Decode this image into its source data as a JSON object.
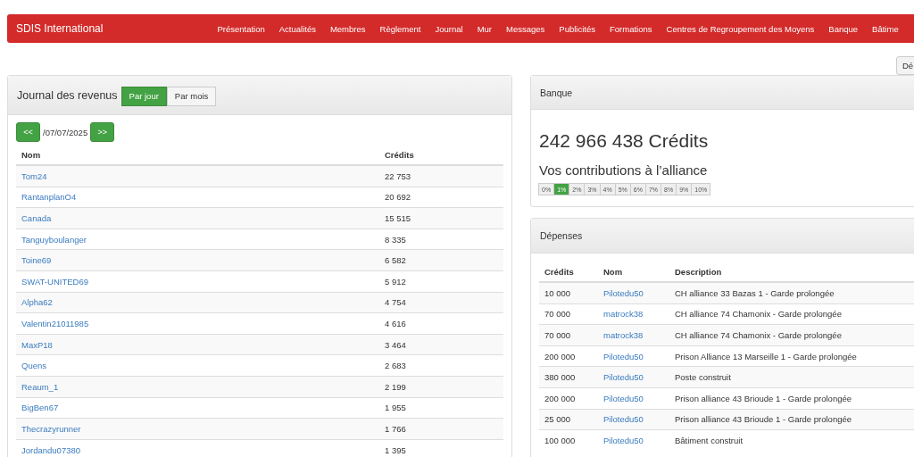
{
  "navbar": {
    "brand": "SDIS International",
    "items": [
      "Présentation",
      "Actualités",
      "Membres",
      "Règlement",
      "Journal",
      "Mur",
      "Messages",
      "Publicités",
      "Formations",
      "Centres de Regroupement des Moyens",
      "Banque",
      "Bâtime"
    ]
  },
  "top_button": "Dé",
  "income_journal": {
    "title": "Journal des revenus",
    "tabs": [
      {
        "label": "Par jour",
        "selected": true
      },
      {
        "label": "Par mois",
        "selected": false
      }
    ],
    "prev": "<<",
    "date": "/07/07/2025",
    "next": ">>",
    "columns": [
      "Nom",
      "Crédits"
    ],
    "rows": [
      {
        "name": "Tom24",
        "credits": "22 753"
      },
      {
        "name": "RantanplanO4",
        "credits": "20 692"
      },
      {
        "name": "Canada",
        "credits": "15 515"
      },
      {
        "name": "Tanguyboulanger",
        "credits": "8 335"
      },
      {
        "name": "Toine69",
        "credits": "6 582"
      },
      {
        "name": "SWAT-UNITED69",
        "credits": "5 912"
      },
      {
        "name": "Alpha62",
        "credits": "4 754"
      },
      {
        "name": "Valentin21011985",
        "credits": "4 616"
      },
      {
        "name": "MaxP18",
        "credits": "3 464"
      },
      {
        "name": "Quens",
        "credits": "2 683"
      },
      {
        "name": "Reaum_1",
        "credits": "2 199"
      },
      {
        "name": "BigBen67",
        "credits": "1 955"
      },
      {
        "name": "Thecrazyrunner",
        "credits": "1 766"
      },
      {
        "name": "Jordandu07380",
        "credits": "1 395"
      }
    ]
  },
  "bank": {
    "title": "Banque",
    "balance": "242 966 438 Crédits",
    "contributions_title": "Vos contributions à l’alliance",
    "options": [
      {
        "label": "0%",
        "selected": false
      },
      {
        "label": "1%",
        "selected": true
      },
      {
        "label": "2%",
        "selected": false
      },
      {
        "label": "3%",
        "selected": false
      },
      {
        "label": "4%",
        "selected": false
      },
      {
        "label": "5%",
        "selected": false
      },
      {
        "label": "6%",
        "selected": false
      },
      {
        "label": "7%",
        "selected": false
      },
      {
        "label": "8%",
        "selected": false
      },
      {
        "label": "9%",
        "selected": false
      },
      {
        "label": "10%",
        "selected": false
      }
    ]
  },
  "expenses": {
    "title": "Dépenses",
    "columns": [
      "Crédits",
      "Nom",
      "Description"
    ],
    "rows": [
      {
        "credits": "10 000",
        "name": "Pilotedu50",
        "description": "CH alliance 33 Bazas 1 - Garde prolongée"
      },
      {
        "credits": "70 000",
        "name": "matrock38",
        "description": "CH alliance 74 Chamonix - Garde prolongée"
      },
      {
        "credits": "70 000",
        "name": "matrock38",
        "description": "CH alliance 74 Chamonix - Garde prolongée"
      },
      {
        "credits": "200 000",
        "name": "Pilotedu50",
        "description": "Prison Alliance 13 Marseille 1 - Garde prolongée"
      },
      {
        "credits": "380 000",
        "name": "Pilotedu50",
        "description": "Poste construit"
      },
      {
        "credits": "200 000",
        "name": "Pilotedu50",
        "description": "Prison alliance 43 Brioude 1 - Garde prolongée"
      },
      {
        "credits": "25 000",
        "name": "Pilotedu50",
        "description": "Prison alliance 43 Brioude 1 - Garde prolongée"
      },
      {
        "credits": "100 000",
        "name": "Pilotedu50",
        "description": "Bâtiment construit"
      }
    ]
  }
}
